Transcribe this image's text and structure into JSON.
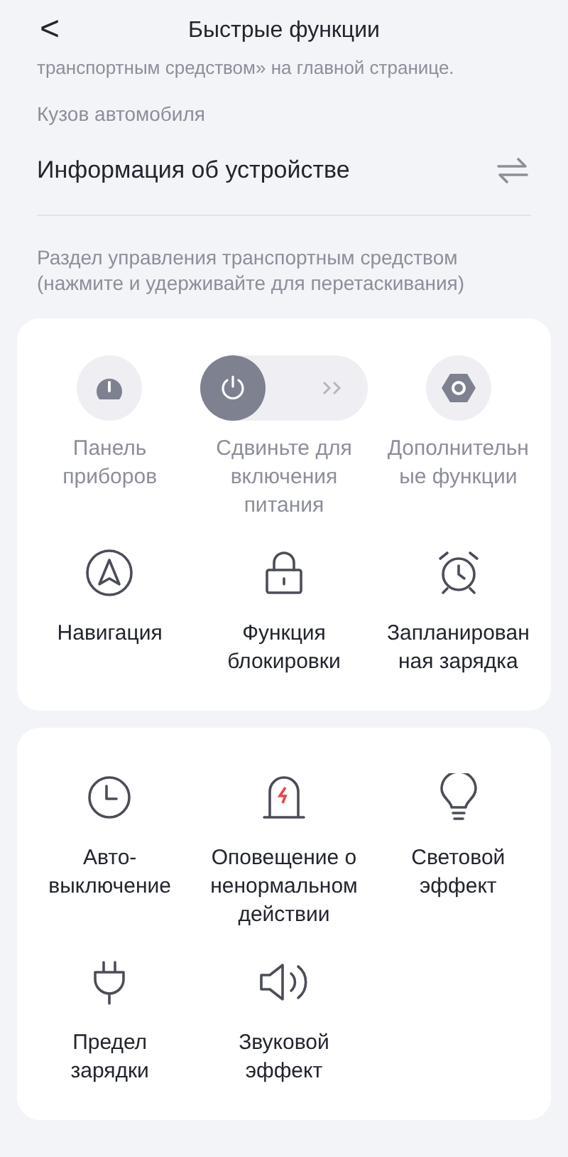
{
  "header": {
    "back": "<",
    "title": "Быстрые функции"
  },
  "cut_text": "транспортным средством» на главной странице.",
  "section_label": "Кузов автомобиля",
  "device_row": {
    "label": "Информация об устройстве"
  },
  "hint": "Раздел управления транспортным средством (нажмите и удерживайте для перетаскивания)",
  "cards": [
    {
      "items": [
        {
          "kind": "round",
          "label": "Панель приборов",
          "disabled": true
        },
        {
          "kind": "slider",
          "label": "Сдвиньте для включения питания",
          "disabled": true,
          "level": 0
        },
        {
          "kind": "round",
          "label": "Дополнительные функции",
          "disabled": true
        },
        {
          "kind": "icon",
          "label": "Навигация",
          "disabled": false
        },
        {
          "kind": "icon",
          "label": "Функция блокировки",
          "disabled": false
        },
        {
          "kind": "icon",
          "label": "Запланированная зарядка",
          "disabled": false
        }
      ]
    },
    {
      "items": [
        {
          "kind": "icon",
          "label": "Авто-выключение",
          "disabled": false
        },
        {
          "kind": "icon",
          "label": "Оповещение о ненормальном действии",
          "disabled": false
        },
        {
          "kind": "icon",
          "label": "Световой эффект",
          "disabled": false
        },
        {
          "kind": "icon",
          "label": "Предел зарядки",
          "disabled": false
        },
        {
          "kind": "icon",
          "label": "Звуковой эффект",
          "disabled": false
        }
      ]
    }
  ]
}
